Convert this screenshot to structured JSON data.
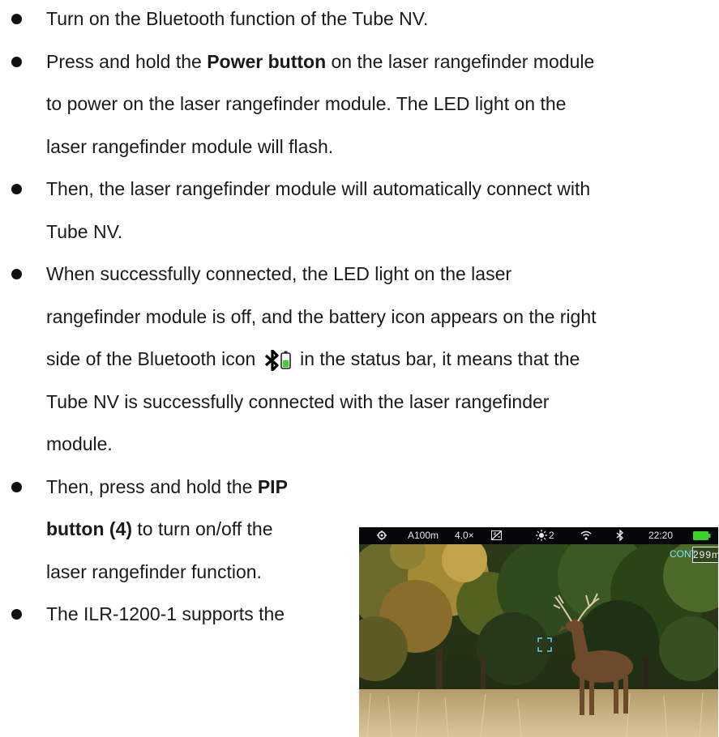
{
  "paragraphs": [
    {
      "lines": [
        [
          "Turn on the Bluetooth function of the Tube NV."
        ]
      ]
    },
    {
      "lines": [
        [
          "Press and hold the ",
          {
            "b": "Power button"
          },
          " on the laser rangefinder module"
        ],
        [
          "to power on the laser rangefinder module. The LED light on the"
        ],
        [
          "laser rangefinder module will flash."
        ]
      ]
    },
    {
      "lines": [
        [
          "Then, the laser rangefinder module will automatically connect with"
        ],
        [
          "Tube NV."
        ]
      ]
    },
    {
      "lines": [
        [
          "When successfully connected, the LED light on the laser"
        ],
        [
          "rangefinder module is off, and the battery icon appears on the right"
        ],
        [
          "side of the Bluetooth icon ",
          {
            "icon": "bluetooth-battery-icon"
          },
          " in the status bar, it means that the"
        ],
        [
          "Tube NV is successfully connected with the laser rangefinder"
        ],
        [
          "module."
        ]
      ]
    },
    {
      "lines": [
        [
          "Then, press and hold the ",
          {
            "b": "PIP"
          }
        ],
        [
          {
            "b": "button (4)"
          },
          " to turn on/off the"
        ],
        [
          "laser rangefinder function."
        ]
      ]
    },
    {
      "lines": [
        [
          "The ILR-1200-1 supports the"
        ]
      ]
    }
  ],
  "status_bar": {
    "mode": "A100m",
    "zoom": "4.0×",
    "brightness": "2",
    "time": "22:20",
    "icons": [
      "settings-icon",
      "image-mode-icon",
      "brightness-icon",
      "wifi-icon",
      "bluetooth-icon",
      "battery-icon"
    ]
  },
  "overlay": {
    "cont_label": "CONT",
    "range": "299m"
  },
  "colors": {
    "battery_green": "#39d12a",
    "overlay_cyan": "#5fd3f0"
  }
}
